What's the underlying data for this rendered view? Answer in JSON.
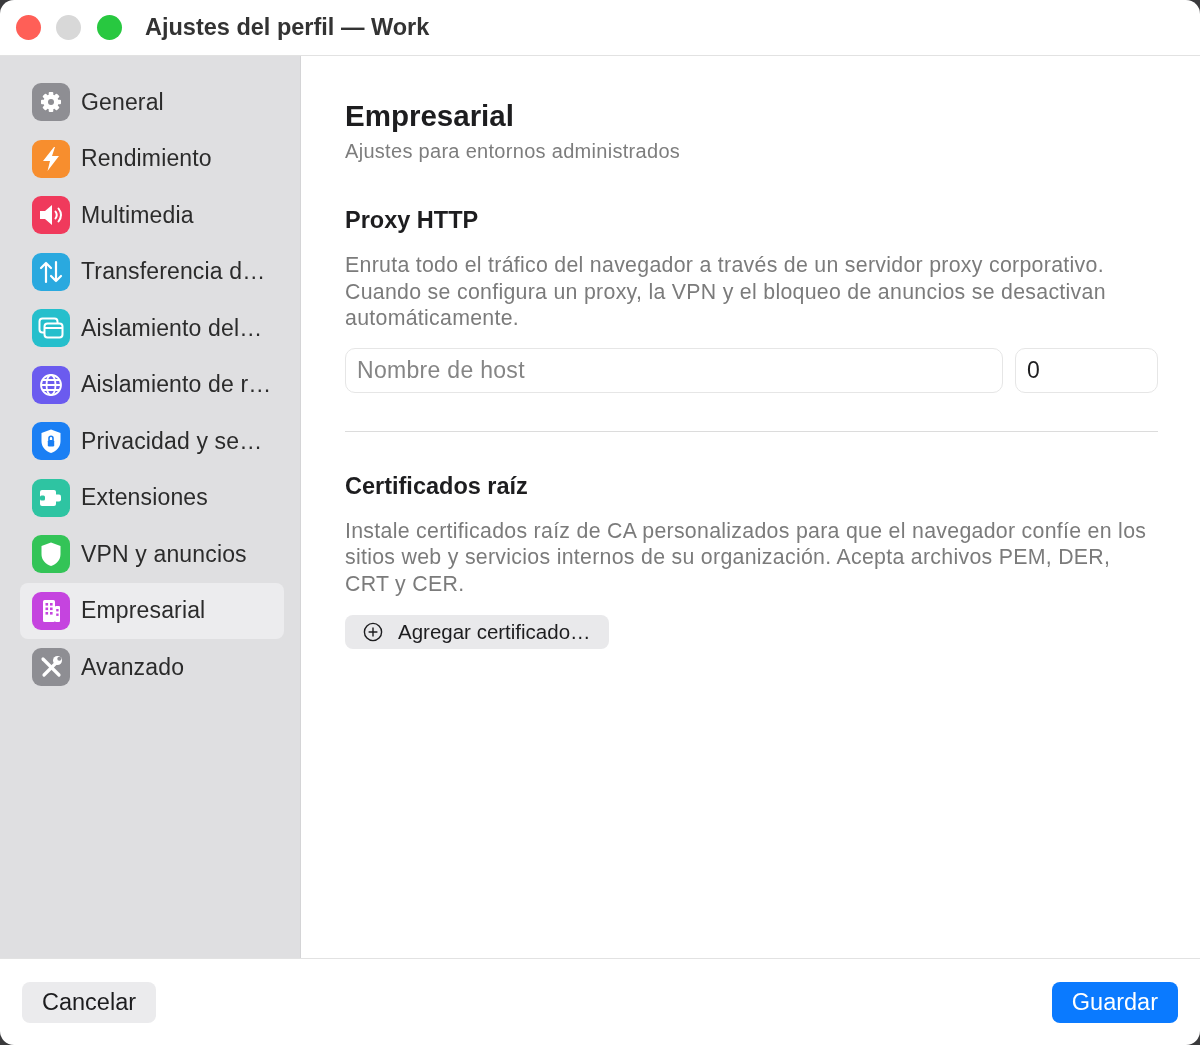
{
  "window": {
    "title": "Ajustes del perfil — Work",
    "controls": [
      {
        "kind": "close",
        "disabled": false
      },
      {
        "kind": "minimize",
        "disabled": true
      },
      {
        "kind": "zoom",
        "disabled": false
      }
    ]
  },
  "sidebar": {
    "items": [
      {
        "label": "General",
        "color": "#8e8e93",
        "selected": false
      },
      {
        "label": "Rendimiento",
        "color": "#f78e2e",
        "selected": false
      },
      {
        "label": "Multimedia",
        "color": "#f03a5c",
        "selected": false
      },
      {
        "label": "Transferencia d…",
        "color": "#2aa9df",
        "selected": false
      },
      {
        "label": "Aislamiento del…",
        "color": "#25bfcc",
        "selected": false
      },
      {
        "label": "Aislamiento de r…",
        "color": "#6b5bef",
        "selected": false
      },
      {
        "label": "Privacidad y se…",
        "color": "#1a7ff4",
        "selected": false
      },
      {
        "label": "Extensiones",
        "color": "#2ec4a2",
        "selected": false
      },
      {
        "label": "VPN y anuncios",
        "color": "#33c457",
        "selected": false
      },
      {
        "label": "Empresarial",
        "color": "#c544df",
        "selected": true
      },
      {
        "label": "Avanzado",
        "color": "#8e8e93",
        "selected": false
      }
    ]
  },
  "content": {
    "title": "Empresarial",
    "subtitle": "Ajustes para entornos administrados",
    "sections": [
      {
        "kind": "proxy",
        "title": "Proxy HTTP",
        "description": "Enruta todo el tráfico del navegador a través de un servidor proxy corporativo. Cuando se configura un proxy, la VPN y el bloqueo de anuncios se desactivan automáticamente.",
        "host_field": {
          "placeholder": "Nombre de host"
        },
        "port_field": {
          "value": "0"
        }
      },
      {
        "kind": "certificates",
        "title": "Certificados raíz",
        "description": "Instale certificados raíz de CA personalizados para que el navegador confíe en los sitios web y servicios internos de su organización. Acepta archivos PEM, DER, CRT y CER.",
        "button": "Agregar certificado…"
      }
    ]
  },
  "footer": {
    "cancel": "Cancelar",
    "save": "Guardar"
  }
}
